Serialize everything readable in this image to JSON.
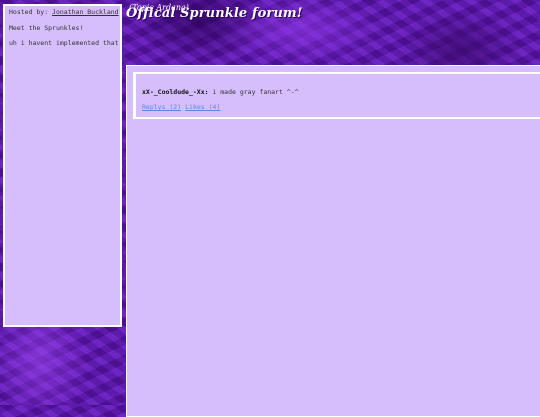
{
  "sidebar": {
    "hosted_prefix": "Hosted by: ",
    "host_name": "Jonathan Buckland",
    "meet_text": "Meet the Sprunkles!",
    "note_text": "uh i havent implemented that"
  },
  "header": {
    "subtitle": "(Topic Ardana)",
    "title": "Offical Sprunkle forum!"
  },
  "posts": [
    {
      "author": "xX-_Cooldude_-Xx:",
      "message": " i made gray fanart ^-^",
      "replies_label": "Replys (2)",
      "likes_label": "Likes (4)"
    }
  ],
  "colors": {
    "panel_bg": "#d6bdfb",
    "page_bg": "#5a1aa8",
    "link": "#5b88e8"
  }
}
